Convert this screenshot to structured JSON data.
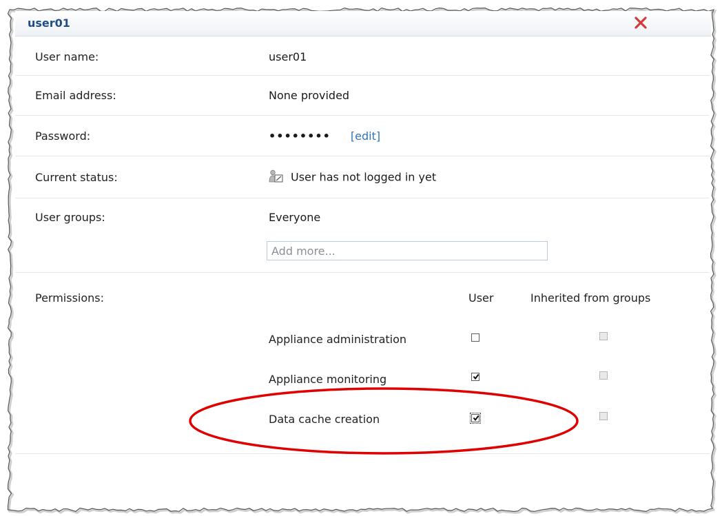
{
  "panel": {
    "title": "user01",
    "close_icon": "close-x-icon",
    "accent_color": "#1f4f87",
    "close_color": "#d43a3a"
  },
  "fields": {
    "user_name": {
      "label": "User name:",
      "value": "user01"
    },
    "email": {
      "label": "Email address:",
      "value": "None provided"
    },
    "password": {
      "label": "Password:",
      "value": "••••••••",
      "edit_link": "[edit]"
    },
    "status": {
      "label": "Current status:",
      "icon": "user-status-icon",
      "value": "User has not logged in yet"
    },
    "groups": {
      "label": "User groups:",
      "value": "Everyone",
      "add_placeholder": "Add more..."
    }
  },
  "permissions": {
    "label": "Permissions:",
    "columns": [
      "User",
      "Inherited from groups"
    ],
    "items": [
      {
        "name": "Appliance administration",
        "user": false,
        "inherited": false
      },
      {
        "name": "Appliance monitoring",
        "user": true,
        "inherited": false
      },
      {
        "name": "Data cache creation",
        "user": true,
        "inherited": false
      }
    ]
  },
  "annotation": {
    "color": "#e00000"
  }
}
